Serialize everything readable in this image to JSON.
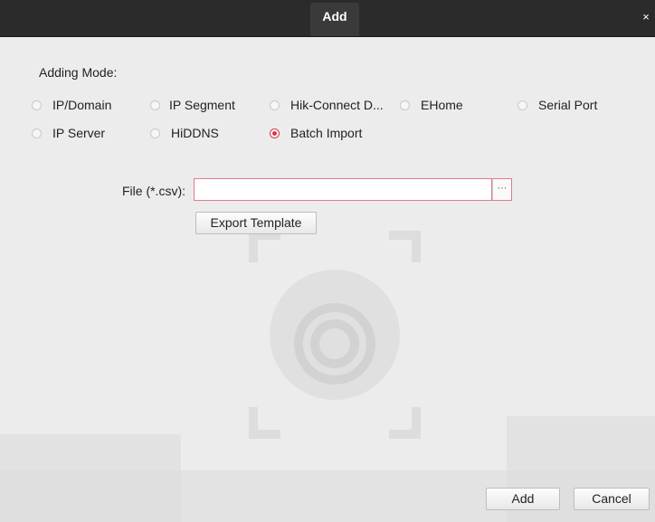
{
  "dialog": {
    "title": "Add",
    "close_glyph": "×"
  },
  "adding_mode": {
    "label": "Adding Mode:",
    "options": [
      {
        "label": "IP/Domain",
        "checked": false
      },
      {
        "label": "IP Segment",
        "checked": false
      },
      {
        "label": "Hik-Connect D...",
        "checked": false
      },
      {
        "label": "EHome",
        "checked": false
      },
      {
        "label": "Serial Port",
        "checked": false
      },
      {
        "label": "IP Server",
        "checked": false
      },
      {
        "label": "HiDDNS",
        "checked": false
      },
      {
        "label": "Batch Import",
        "checked": true
      }
    ]
  },
  "file": {
    "label": "File (*.csv):",
    "value": "",
    "browse_label": "···"
  },
  "export_template_label": "Export Template",
  "footer": {
    "add_label": "Add",
    "cancel_label": "Cancel"
  },
  "colors": {
    "titlebar": "#2b2b2b",
    "accent": "#e0334a",
    "background": "#ececec"
  }
}
